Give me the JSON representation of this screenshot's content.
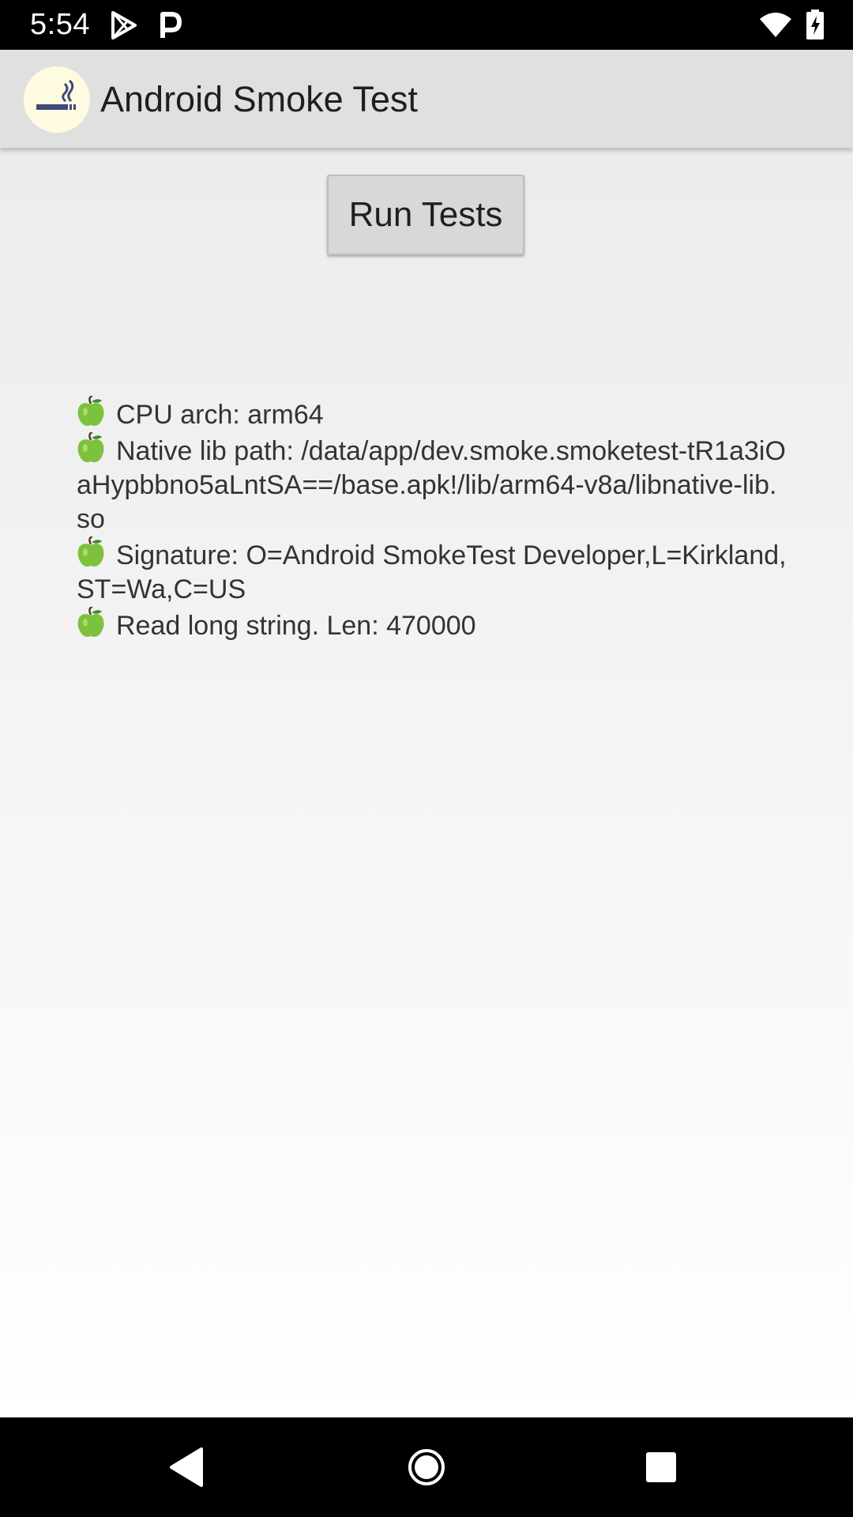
{
  "status_bar": {
    "time": "5:54",
    "left_icons": [
      "play-store-icon",
      "parking-icon"
    ],
    "right_icons": [
      "wifi-icon",
      "battery-icon"
    ]
  },
  "app_bar": {
    "title": "Android Smoke Test",
    "logo_icon": "cigarette-icon"
  },
  "main": {
    "run_button_label": "Run Tests",
    "result_icon": "green-apple-icon",
    "results": [
      "CPU arch: arm64",
      "Native lib path: /data/app/dev.smoke.smoketest-tR1a3iOaHypbbno5aLntSA==/base.apk!/lib/arm64-v8a/libnative-lib.so",
      "Signature: O=Android SmokeTest Developer,L=Kirkland,ST=Wa,C=US",
      "Read long string. Len: 470000"
    ]
  },
  "nav_bar": {
    "buttons": [
      "back-icon",
      "home-icon",
      "recents-icon"
    ]
  },
  "colors": {
    "app_bar": "#e0e0e0",
    "logo_bg": "#fffbe0",
    "button_bg": "#d8d8d8",
    "apple_green": "#7cc23c"
  }
}
